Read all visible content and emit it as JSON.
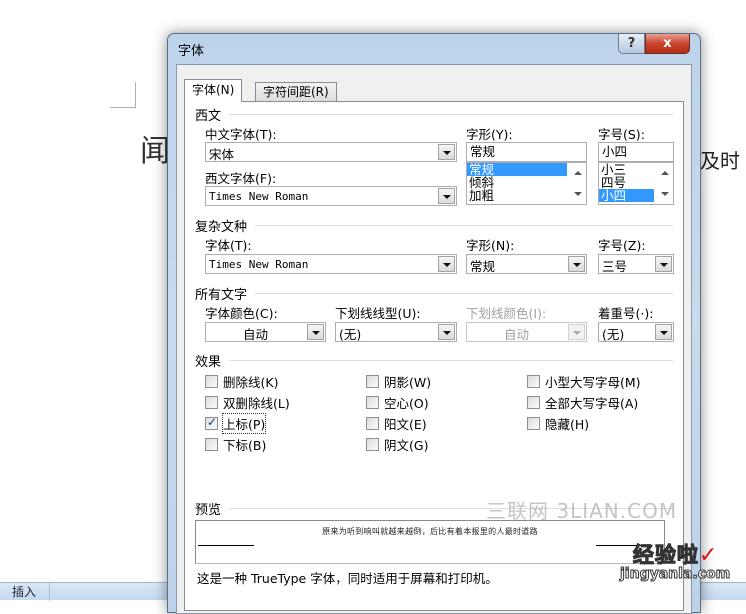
{
  "background": {
    "doc_text_left": "闻",
    "doc_text_right": "及时",
    "ribbon_tab": "插入"
  },
  "dialog": {
    "title": "字体",
    "help_label": "?",
    "close_label": "x",
    "tabs": [
      {
        "label": "字体(N)",
        "active": true
      },
      {
        "label": "字符间距(R)",
        "active": false
      }
    ],
    "western": {
      "section": "西文",
      "chinese_font_label": "中文字体(T):",
      "chinese_font_value": "宋体",
      "western_font_label": "西文字体(F):",
      "western_font_value": "Times New Roman",
      "style_label": "字形(Y):",
      "style_value": "常规",
      "style_options": [
        "常规",
        "倾斜",
        "加粗"
      ],
      "style_selected": "常规",
      "size_label": "字号(S):",
      "size_value": "小四",
      "size_options": [
        "小三",
        "四号",
        "小四"
      ],
      "size_selected": "小四"
    },
    "complex": {
      "section": "复杂文种",
      "font_label": "字体(T):",
      "font_value": "Times New Roman",
      "style_label": "字形(N):",
      "style_value": "常规",
      "size_label": "字号(Z):",
      "size_value": "三号"
    },
    "all_text": {
      "section": "所有文字",
      "font_color_label": "字体颜色(C):",
      "font_color_value": "自动",
      "underline_style_label": "下划线线型(U):",
      "underline_style_value": "(无)",
      "underline_color_label": "下划线颜色(I):",
      "underline_color_value": "自动",
      "emphasis_label": "着重号(·):",
      "emphasis_value": "(无)"
    },
    "effects": {
      "section": "效果",
      "items": [
        {
          "label": "删除线(K)",
          "checked": false
        },
        {
          "label": "双删除线(L)",
          "checked": false
        },
        {
          "label": "上标(P)",
          "checked": true
        },
        {
          "label": "下标(B)",
          "checked": false
        },
        {
          "label": "阴影(W)",
          "checked": false
        },
        {
          "label": "空心(O)",
          "checked": false
        },
        {
          "label": "阳文(E)",
          "checked": false
        },
        {
          "label": "阴文(G)",
          "checked": false
        },
        {
          "label": "小型大写字母(M)",
          "checked": false
        },
        {
          "label": "全部大写字母(A)",
          "checked": false
        },
        {
          "label": "隐藏(H)",
          "checked": false
        }
      ]
    },
    "preview": {
      "section": "预览",
      "sample": "原来为听到响叫就越来越倒，后比有着本报里的人最时道路",
      "note": "这是一种 TrueType 字体，同时适用于屏幕和打印机。"
    }
  },
  "watermarks": {
    "site1": "三联网 3LIAN.COM",
    "site2_cn": "经验啦",
    "site2_check": "✓",
    "site2_en": "jingyanla.com"
  }
}
